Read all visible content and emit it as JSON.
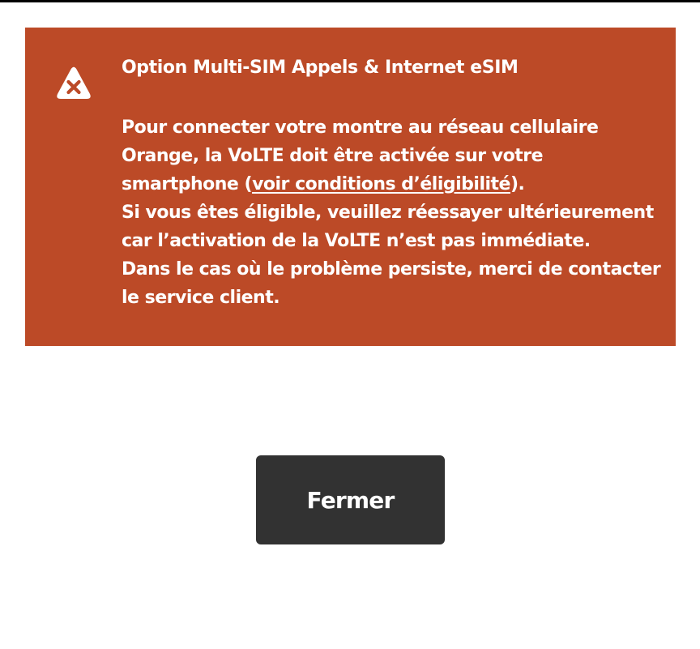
{
  "colors": {
    "alert_background": "#BC4A27",
    "alert_text": "#FFFFFF",
    "button_background": "#323232",
    "button_text": "#FFFFFF",
    "page_background": "#FFFFFF"
  },
  "alert": {
    "icon": "error-triangle-icon",
    "title": "Option Multi-SIM Appels & Internet eSIM",
    "body": {
      "line_1": "Pour connecter votre montre au réseau cellulaire",
      "line_2": "Orange, la VoLTE doit être activée sur votre",
      "line_3_before_link": "smartphone (",
      "link_label": "voir conditions d’éligibilité",
      "line_3_after_link": ").",
      "line_4": "Si vous êtes éligible, veuillez réessayer ultérieurement",
      "line_5": "car l’activation de la VoLTE n’est pas immédiate.",
      "line_6": "Dans le cas où le problème persiste, merci de contacter",
      "line_7": "le service client."
    }
  },
  "actions": {
    "close_label": "Fermer"
  }
}
